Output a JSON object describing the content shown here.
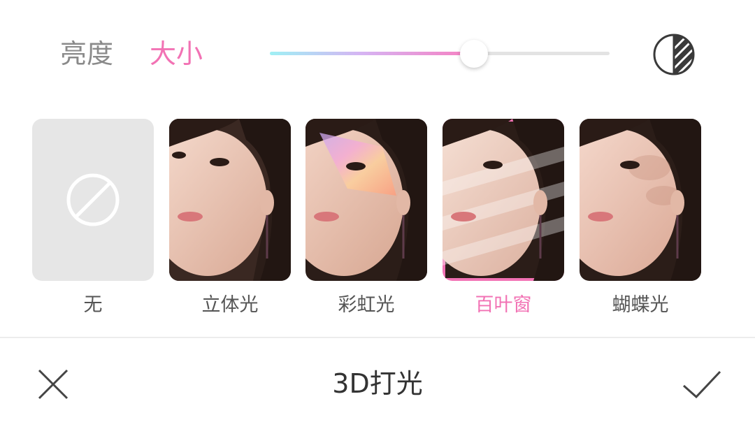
{
  "tabs": {
    "brightness": "亮度",
    "size": "大小"
  },
  "slider": {
    "level_fraction": 0.6
  },
  "compare_icon": "half-contrast-icon",
  "filters": [
    {
      "label": "无",
      "icon": "no-effect-icon",
      "selected": false
    },
    {
      "label": "立体光",
      "selected": false
    },
    {
      "label": "彩虹光",
      "selected": false
    },
    {
      "label": "百叶窗",
      "selected": true
    },
    {
      "label": "蝴蝶光",
      "selected": false
    }
  ],
  "bottom_bar": {
    "title": "3D打光",
    "cancel_icon": "close-icon",
    "confirm_icon": "check-icon"
  },
  "colors": {
    "accent": "#f272b4",
    "inactive_text": "#8a8a8a"
  }
}
